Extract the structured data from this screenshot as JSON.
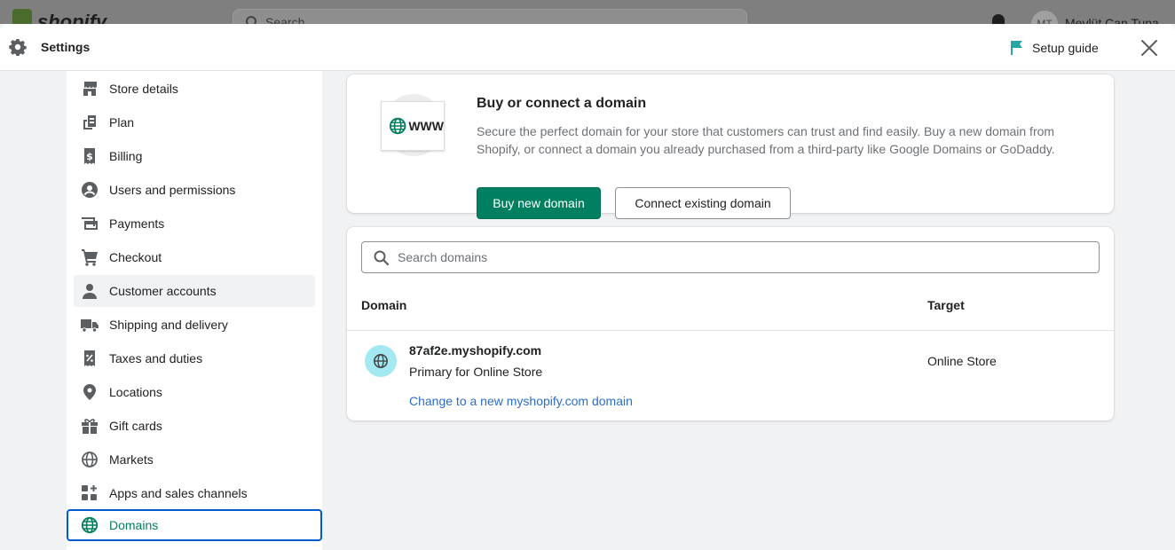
{
  "background": {
    "logo_text": "shopify",
    "search_placeholder": "Search",
    "avatar_initials": "MT",
    "user_name": "Mevlüt Can Tuna"
  },
  "header": {
    "title": "Settings",
    "setup_guide": "Setup guide"
  },
  "sidebar": {
    "items": [
      {
        "label": "Store details",
        "icon": "store-icon"
      },
      {
        "label": "Plan",
        "icon": "plan-icon"
      },
      {
        "label": "Billing",
        "icon": "billing-icon"
      },
      {
        "label": "Users and permissions",
        "icon": "user-circle-icon"
      },
      {
        "label": "Payments",
        "icon": "payments-icon"
      },
      {
        "label": "Checkout",
        "icon": "cart-icon"
      },
      {
        "label": "Customer accounts",
        "icon": "person-icon"
      },
      {
        "label": "Shipping and delivery",
        "icon": "truck-icon"
      },
      {
        "label": "Taxes and duties",
        "icon": "tax-icon"
      },
      {
        "label": "Locations",
        "icon": "location-pin-icon"
      },
      {
        "label": "Gift cards",
        "icon": "gift-icon"
      },
      {
        "label": "Markets",
        "icon": "globe-outline-icon"
      },
      {
        "label": "Apps and sales channels",
        "icon": "apps-icon"
      },
      {
        "label": "Domains",
        "icon": "globe-icon"
      }
    ],
    "hover_index": 6,
    "active_index": 13
  },
  "domain_card": {
    "illustration_text": "WWW",
    "heading": "Buy or connect a domain",
    "description": "Secure the perfect domain for your store that customers can trust and find easily. Buy a new domain from Shopify, or connect a domain you already purchased from a third-party like Google Domains or GoDaddy.",
    "buy_button": "Buy new domain",
    "connect_button": "Connect existing domain"
  },
  "domains_table": {
    "search_placeholder": "Search domains",
    "columns": {
      "domain": "Domain",
      "target": "Target"
    },
    "rows": [
      {
        "domain": "87af2e.myshopify.com",
        "subtitle": "Primary for Online Store",
        "link": "Change to a new myshopify.com domain",
        "target": "Online Store"
      }
    ]
  },
  "colors": {
    "primary_green": "#008060",
    "active_text": "#007f5f",
    "focus_border": "#005bd3",
    "link_blue": "#2c6ecb",
    "domain_icon_bg": "#a4e8f2",
    "setup_flag": "#2aa5a5"
  }
}
